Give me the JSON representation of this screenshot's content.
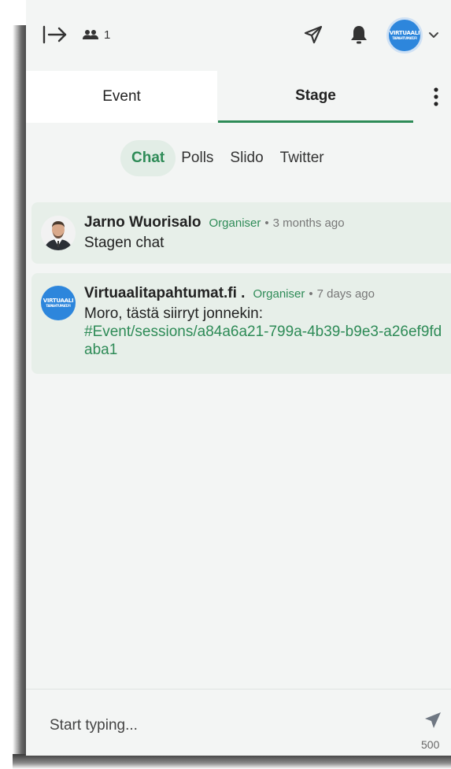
{
  "header": {
    "collapse_icon": "collapse-right-icon",
    "attendee_icon": "people-icon",
    "attendee_count": "1",
    "send_icon": "paper-plane-icon",
    "bell_icon": "bell-icon",
    "avatar_logo_line1": "VIRTUAALI",
    "avatar_logo_line2": "TAPAHTUMAT.FI",
    "menu_icon": "chevron-down-icon"
  },
  "tabs": [
    {
      "label": "Event",
      "active": false
    },
    {
      "label": "Stage",
      "active": true
    }
  ],
  "subtabs": [
    {
      "label": "Chat",
      "active": true
    },
    {
      "label": "Polls",
      "active": false
    },
    {
      "label": "Slido",
      "active": false
    },
    {
      "label": "Twitter",
      "active": false
    }
  ],
  "messages": [
    {
      "author": "Jarno Wuorisalo",
      "role": "Organiser",
      "separator": "•",
      "time": "3 months ago",
      "text": "Stagen chat",
      "link": ""
    },
    {
      "author": "Virtuaalitapahtumat.fi .",
      "role": "Organiser",
      "separator": "•",
      "time": "7 days ago",
      "text": "Moro, tästä siirryt jonnekin:",
      "link": "#Event/sessions/a84a6a21-799a-4b39-b9e3-a26ef9fdaba1",
      "avatar_logo_line1": "VIRTUAALI",
      "avatar_logo_line2": "TAPAHTUMAT.FI"
    }
  ],
  "composer": {
    "placeholder": "Start typing...",
    "value": "",
    "char_limit": "500",
    "send_icon": "paper-plane-icon"
  },
  "colors": {
    "accent": "#2e8b57",
    "panel_bg": "#f3f5f4",
    "message_bg": "#e7efe9",
    "avatar_blue": "#2d86dc"
  }
}
